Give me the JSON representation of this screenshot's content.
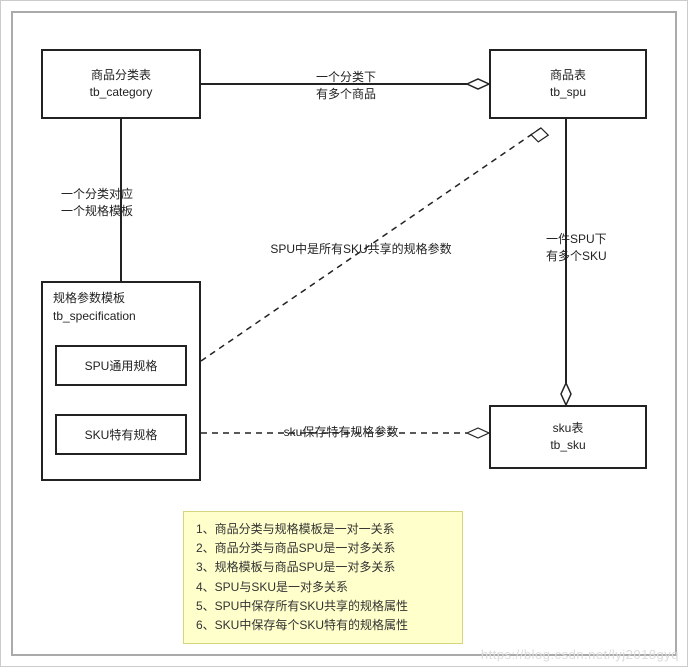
{
  "boxes": {
    "category": {
      "title": "商品分类表",
      "subtitle": "tb_category"
    },
    "spu": {
      "title": "商品表",
      "subtitle": "tb_spu"
    },
    "spec": {
      "title": "规格参数模板",
      "subtitle": "tb_specification",
      "sub": {
        "common": "SPU通用规格",
        "specific": "SKU特有规格"
      }
    },
    "sku": {
      "title": "sku表",
      "subtitle": "tb_sku"
    }
  },
  "edges": {
    "cat_spu": {
      "l1": "一个分类下",
      "l2": "有多个商品"
    },
    "cat_spec": {
      "l1": "一个分类对应",
      "l2": "一个规格模板"
    },
    "spu_sku": {
      "l1": "一件SPU下",
      "l2": "有多个SKU"
    },
    "spec_spu": {
      "l1": "SPU中是所有SKU共享的规格参数"
    },
    "spec_sku": {
      "l1": "sku保存特有规格参数"
    }
  },
  "note": {
    "lines": [
      "1、商品分类与规格模板是一对一关系",
      "2、商品分类与商品SPU是一对多关系",
      "3、规格模板与商品SPU是一对多关系",
      "4、SPU与SKU是一对多关系",
      "5、SPU中保存所有SKU共享的规格属性",
      "6、SKU中保存每个SKU特有的规格属性"
    ]
  },
  "watermark": "https://blog.csdn.net/lyj2018gyq"
}
